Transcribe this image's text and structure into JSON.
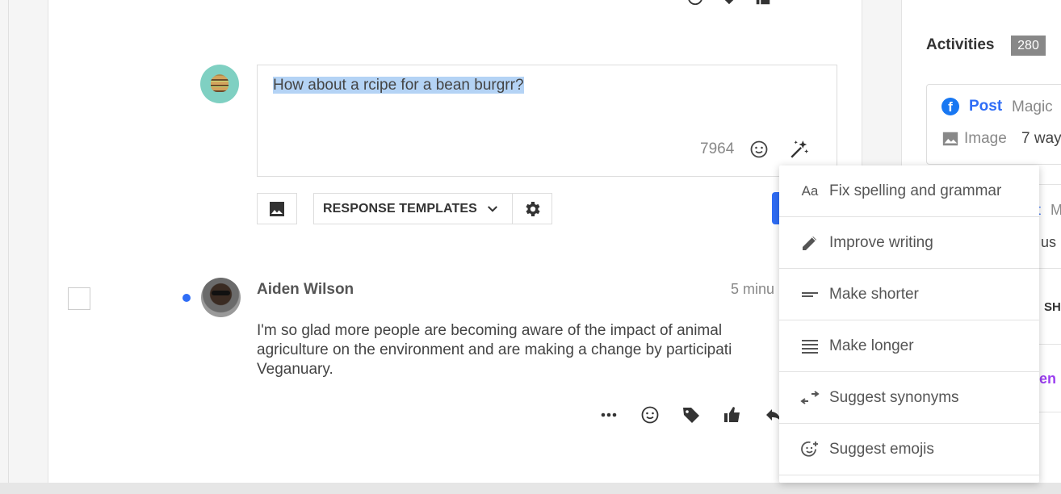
{
  "composer": {
    "text": "How about a rcipe for a bean burgrr?",
    "char_count": "7964",
    "templates_label": "RESPONSE TEMPLATES"
  },
  "comment": {
    "author": "Aiden Wilson",
    "time": "5 minu",
    "body": "I'm so glad more people are becoming aware of the impact of animal agriculture on the environment and are making a change by participati Veganuary."
  },
  "activities": {
    "title": "Activities",
    "count": "280",
    "card": {
      "type_label": "Post",
      "title_peek": "Magic",
      "media_label": "Image",
      "text_peek": "7 way"
    },
    "peeks": [
      "t",
      "M",
      "us",
      "SH",
      "en"
    ]
  },
  "menu": {
    "items": [
      {
        "icon": "text-format-icon",
        "glyph": "Aa",
        "label": "Fix spelling and grammar"
      },
      {
        "icon": "pencil-icon",
        "glyph": "",
        "label": "Improve writing"
      },
      {
        "icon": "short-text-icon",
        "glyph": "",
        "label": "Make shorter"
      },
      {
        "icon": "long-text-icon",
        "glyph": "",
        "label": "Make longer"
      },
      {
        "icon": "swap-arrows-icon",
        "glyph": "",
        "label": "Suggest synonyms"
      },
      {
        "icon": "add-emoji-icon",
        "glyph": "",
        "label": "Suggest emojis"
      }
    ]
  },
  "colors": {
    "accent": "#2f6df6",
    "facebook": "#1877f2",
    "selection": "#b4d3f5",
    "badge": "#888888",
    "purple_peek": "#9b3ef0"
  }
}
